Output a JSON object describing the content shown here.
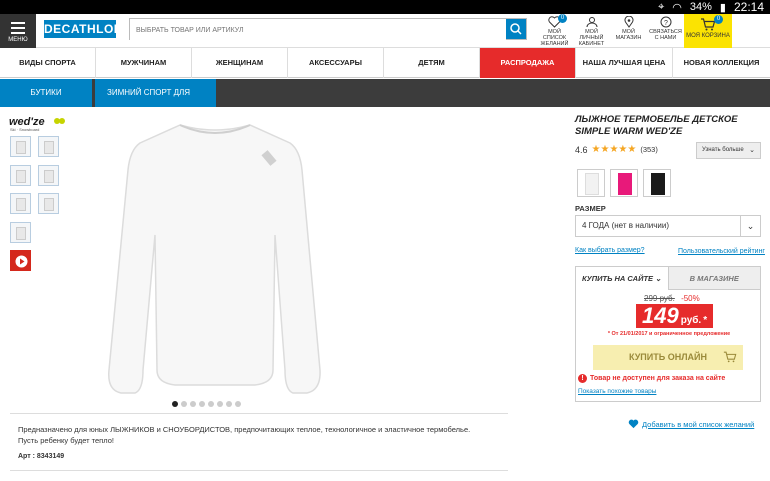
{
  "status": {
    "battery": "34%",
    "time": "22:14"
  },
  "header": {
    "menu_label": "МЕНЮ",
    "logo": "DECATHLON",
    "search_placeholder": "ВЫБРАТЬ ТОВАР ИЛИ АРТИКУЛ",
    "icons": [
      {
        "label": "МОЙ СПИСОК ЖЕЛАНИЙ",
        "icon": "heart-icon",
        "badge": "0"
      },
      {
        "label": "МОЙ ЛИЧНЫЙ КАБИНЕТ",
        "icon": "user-icon"
      },
      {
        "label": "МОЙ МАГАЗИН",
        "icon": "location-pin-icon"
      },
      {
        "label": "СВЯЗАТЬСЯ С НАМИ",
        "icon": "help-icon"
      }
    ],
    "cart": {
      "label": "МОЯ КОРЗИНА",
      "badge": "0"
    }
  },
  "nav": [
    "ВИДЫ СПОРТА",
    "МУЖЧИНАМ",
    "ЖЕНЩИНАМ",
    "АКСЕССУАРЫ",
    "ДЕТЯМ",
    "РАСПРОДАЖА",
    "НАША ЛУЧШАЯ ЦЕНА",
    "НОВАЯ КОЛЛЕКЦИЯ"
  ],
  "breadcrumbs": [
    "БУТИКИ",
    "ЗИМНИЙ СПОРТ ДЛЯ ДЕТЕЙ"
  ],
  "brand": "wed'ze",
  "brand_sub": "Ski · Snowboard",
  "gallery": {
    "slide_count": 8,
    "active_slide": 0
  },
  "product": {
    "title": "ЛЫЖНОЕ ТЕРМОБЕЛЬЕ ДЕТСКОЕ SIMPLE WARM WED'ZE",
    "rating": "4.6",
    "reviews": "(353)",
    "more_button": "Узнать больше",
    "colors": [
      "#f2f2f2",
      "#e8197a",
      "#1a1a1a"
    ],
    "size_label": "РАЗМЕР",
    "size_value": "4 ГОДА (нет в наличии)",
    "size_link": "Как выбрать размер?",
    "rating_link": "Пользовательский рейтинг",
    "tab_online": "КУПИТЬ НА САЙТЕ",
    "tab_store": "В МАГАЗИНЕ",
    "old_price": "299 руб.",
    "discount": "-50%",
    "price": "149",
    "price_cur": "руб.",
    "price_star": "*",
    "promo": "* От 21/01/2017 и ограниченное предложение",
    "buy_button": "КУПИТЬ ОНЛАЙН",
    "unavailable": "Товар не доступен для заказа на сайте",
    "similar_link": "Показать похожие товары",
    "wishlist_link": "Добавить в мой список желаний",
    "description": "Предназначено для юных ЛЫЖНИКОВ и СНОУБОРДИСТОВ, предпочитающих теплое, технологичное и эластичное термобелье. Пусть ребенку будет тепло!",
    "article": "Арт : 8343149"
  }
}
